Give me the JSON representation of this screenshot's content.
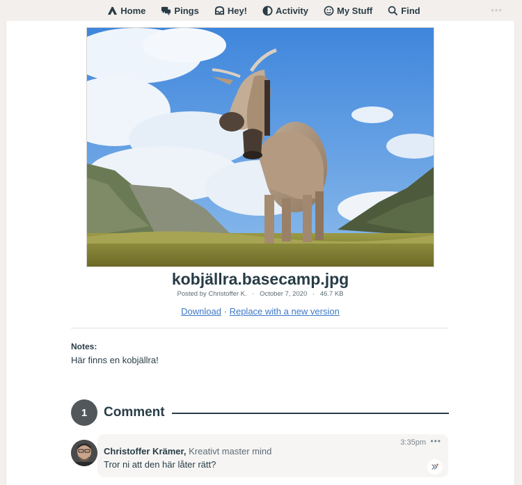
{
  "nav": {
    "items": [
      {
        "label": "Home",
        "icon": "home-icon"
      },
      {
        "label": "Pings",
        "icon": "pings-icon"
      },
      {
        "label": "Hey!",
        "icon": "hey-icon"
      },
      {
        "label": "Activity",
        "icon": "activity-icon"
      },
      {
        "label": "My Stuff",
        "icon": "my-stuff-icon"
      },
      {
        "label": "Find",
        "icon": "search-icon"
      }
    ],
    "more": "•••"
  },
  "file": {
    "name": "kobjällra.basecamp.jpg",
    "posted_by": "Posted by Christoffer K.",
    "date": "October 7, 2020",
    "size": "46.7 KB",
    "separator": "·",
    "download_label": "Download",
    "action_separator": "·",
    "replace_label": "Replace with a new version"
  },
  "notes": {
    "label": "Notes:",
    "text": "Här finns en kobjällra!"
  },
  "comments": {
    "count": "1",
    "title": "Comment",
    "items": [
      {
        "author": "Christoffer Krämer,",
        "role": "Kreativt master mind",
        "time": "3:35pm",
        "menu": "•••",
        "body": "Tror ni att den här låter rätt?"
      }
    ]
  },
  "colors": {
    "background": "#f3efec",
    "text": "#283c46",
    "link": "#3c78c8",
    "badge": "#51575b"
  }
}
